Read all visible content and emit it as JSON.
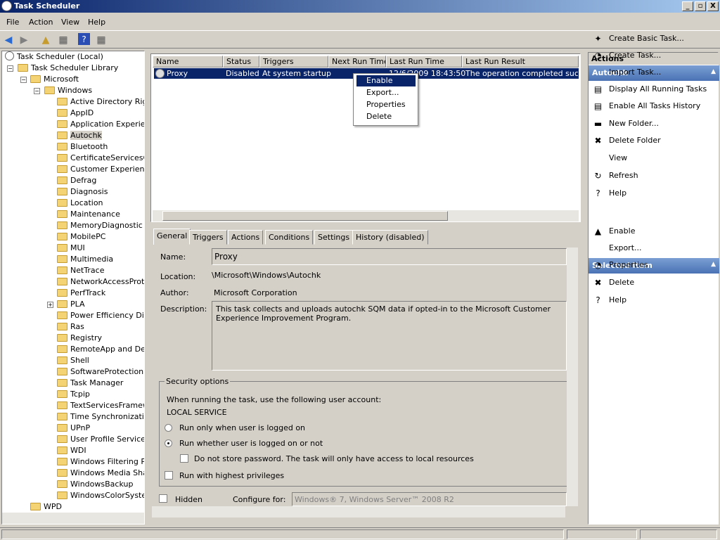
{
  "window": {
    "title": "Task Scheduler",
    "controls": [
      "_",
      "▫",
      "X"
    ]
  },
  "menu": [
    "File",
    "Action",
    "View",
    "Help"
  ],
  "tree": {
    "root": "Task Scheduler (Local)",
    "library": "Task Scheduler Library",
    "microsoft": "Microsoft",
    "windows": "Windows",
    "items": [
      "Active Directory Rights",
      "AppID",
      "Application Experience",
      "Autochk",
      "Bluetooth",
      "CertificateServicesClient",
      "Customer Experience",
      "Defrag",
      "Diagnosis",
      "Location",
      "Maintenance",
      "MemoryDiagnostic",
      "MobilePC",
      "MUI",
      "Multimedia",
      "NetTrace",
      "NetworkAccessProtection",
      "PerfTrack",
      "PLA",
      "Power Efficiency Diagnostics",
      "Ras",
      "Registry",
      "RemoteApp and Desktop",
      "Shell",
      "SoftwareProtectionPlatform",
      "Task Manager",
      "Tcpip",
      "TextServicesFramework",
      "Time Synchronization",
      "UPnP",
      "User Profile Service",
      "WDI",
      "Windows Filtering Platform",
      "Windows Media Sharing",
      "WindowsBackup",
      "WindowsColorSystem"
    ],
    "wpd": "WPD",
    "selected": "Autochk"
  },
  "tasklist": {
    "columns": [
      "Name",
      "Status",
      "Triggers",
      "Next Run Time",
      "Last Run Time",
      "Last Run Result"
    ],
    "rows": [
      {
        "name": "Proxy",
        "status": "Disabled",
        "triggers": "At system startup",
        "next": "",
        "last": "12/6/2009 18:43:50",
        "result": "The operation completed successfully."
      }
    ]
  },
  "context_menu": [
    "Enable",
    "Export...",
    "Properties",
    "Delete"
  ],
  "details": {
    "tabs": [
      "General",
      "Triggers",
      "Actions",
      "Conditions",
      "Settings",
      "History (disabled)"
    ],
    "name_label": "Name:",
    "name": "Proxy",
    "location_label": "Location:",
    "location": "\\Microsoft\\Windows\\Autochk",
    "author_label": "Author:",
    "author": "Microsoft Corporation",
    "description_label": "Description:",
    "description": "This task collects and uploads autochk SQM data if opted-in to the Microsoft Customer Experience Improvement Program.",
    "security_title": "Security options",
    "account_prompt": "When running the task, use the following user account:",
    "account": "LOCAL SERVICE",
    "radio1": "Run only when user is logged on",
    "radio2": "Run whether user is logged on or not",
    "nostore": "Do not store password.  The task will only have access to local resources",
    "highest": "Run with highest privileges",
    "hidden": "Hidden",
    "configure_label": "Configure for:",
    "configure": "Windows® 7, Windows Server™ 2008 R2"
  },
  "actions": {
    "title": "Actions",
    "section1": "Autochk",
    "items1": [
      "Create Basic Task...",
      "Create Task...",
      "Import Task...",
      "Display All Running Tasks",
      "Enable All Tasks History",
      "New Folder...",
      "Delete Folder",
      "View",
      "Refresh",
      "Help"
    ],
    "section2": "Selected Item",
    "items2": [
      "Enable",
      "Export...",
      "Properties",
      "Delete",
      "Help"
    ]
  },
  "colors": {
    "title": "#0a246a",
    "selection": "#0a246a",
    "actionhead": "#4a72b4"
  }
}
